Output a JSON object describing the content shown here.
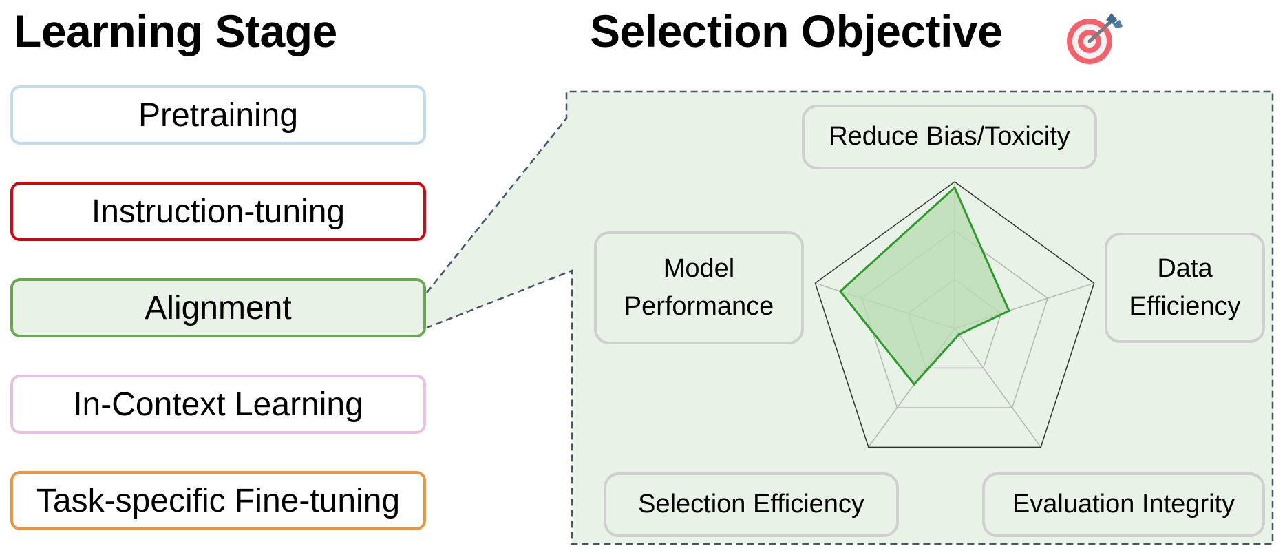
{
  "left_panel": {
    "title": "Learning Stage",
    "stages": [
      {
        "label": "Pretraining",
        "border_color": "#c2dbec",
        "fill": "#ffffff"
      },
      {
        "label": "Instruction-tuning",
        "border_color": "#d0050f",
        "fill": "#ffffff"
      },
      {
        "label": "Alignment",
        "border_color": "#6aa84f",
        "fill": "#e9f2e6",
        "selected": true
      },
      {
        "label": "In-Context Learning",
        "border_color": "#e6bfe1",
        "fill": "#ffffff"
      },
      {
        "label": "Task-specific Fine-tuning",
        "border_color": "#e8953f",
        "fill": "#ffffff"
      }
    ]
  },
  "right_panel": {
    "title": "Selection Objective",
    "title_icon": "target-with-arrow-icon",
    "panel_fill": "#e9f2e6",
    "panel_border": "#44546a",
    "objectives": {
      "top": "Reduce Bias/Toxicity",
      "right_line1": "Data",
      "right_line2": "Efficiency",
      "left_line1": "Model",
      "left_line2": "Performance",
      "bottom_left": "Selection Efficiency",
      "bottom_right": "Evaluation Integrity"
    }
  },
  "chart_data": {
    "type": "radar",
    "title": "",
    "axes": [
      "Reduce Bias/Toxicity",
      "Data Efficiency",
      "Evaluation Integrity",
      "Selection Efficiency",
      "Model Performance"
    ],
    "series": [
      {
        "name": "Alignment",
        "values": [
          0.96,
          0.39,
          0.05,
          0.47,
          0.82
        ],
        "color": "#2e9a2e",
        "fill": "#b9dcb3"
      }
    ],
    "range": [
      0,
      1
    ],
    "grid_levels": [
      0.333,
      0.667,
      1.0
    ],
    "grid": true,
    "legend": "none"
  }
}
